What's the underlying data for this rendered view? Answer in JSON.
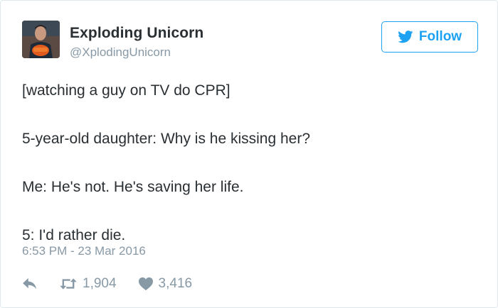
{
  "tweet": {
    "author": {
      "name": "Exploding Unicorn",
      "handle": "@XplodingUnicorn",
      "avatar_icon": "profile-photo"
    },
    "follow_label": "Follow",
    "text_lines": [
      "[watching a guy on TV do CPR]",
      "5-year-old daughter: Why is he kissing her?",
      "Me: He's not. He's saving her life.",
      "5: I'd rather die."
    ],
    "timestamp": "6:53 PM - 23 Mar 2016",
    "actions": {
      "reply_icon": "reply-icon",
      "retweet_icon": "retweet-icon",
      "retweets": "1,904",
      "like_icon": "heart-icon",
      "likes": "3,416"
    }
  },
  "colors": {
    "accent": "#1da1f2",
    "text": "#292f33",
    "muted": "#8899a6",
    "border": "#e1e8ed"
  }
}
